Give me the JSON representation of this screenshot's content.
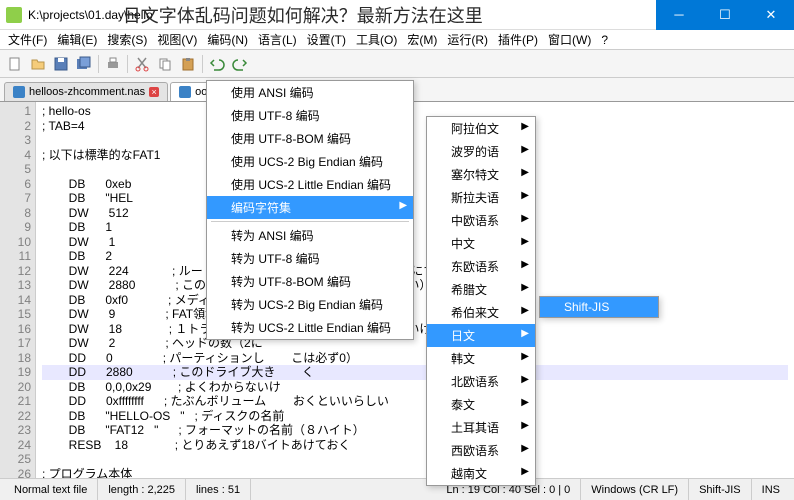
{
  "title_path": "K:\\projects\\01.day\\hello",
  "title_overlay": "日文字体乱码问题如何解决？最新方法在这里",
  "menubar": [
    "文件(F)",
    "编辑(E)",
    "搜索(S)",
    "视图(V)",
    "编码(N)",
    "语言(L)",
    "设置(T)",
    "工具(O)",
    "宏(M)",
    "运行(R)",
    "插件(P)",
    "窗口(W)",
    "?"
  ],
  "tabs": [
    {
      "label": "helloos-zhcomment.nas",
      "active": false
    },
    {
      "label": "oos.nas",
      "active": true
    }
  ],
  "code": [
    {
      "n": 1,
      "t": "; hello-os"
    },
    {
      "n": 2,
      "t": "; TAB=4"
    },
    {
      "n": 3,
      "t": ""
    },
    {
      "n": 4,
      "t": "; 以下は標準的なFAT1"
    },
    {
      "n": 5,
      "t": ""
    },
    {
      "n": 6,
      "t": "        DB      0xeb"
    },
    {
      "n": 7,
      "t": "        DB      \"HEL"
    },
    {
      "n": 8,
      "t": "        DW      512                                     てよい（８バイト）"
    },
    {
      "n": 9,
      "t": "        DB      1                                       ばいけない）"
    },
    {
      "n": 10,
      "t": "        DW      1                                       ければいけない）"
    },
    {
      "n": 11,
      "t": "        DB      2                                       セクタ目からにする）"
    },
    {
      "n": 12,
      "t": "        DW      224             ; ルートディレク          （普通は224エントリにす"
    },
    {
      "n": 13,
      "t": "        DW      2880            ; このドライブの          にしなければいけない）"
    },
    {
      "n": 14,
      "t": "        DB      0xf0            ; メディアのタイ"
    },
    {
      "n": 15,
      "t": "        DW      9               ; FAT領域の長さ"
    },
    {
      "n": 16,
      "t": "        DW      18              ; １トラックにいく        か（18にしなければいけない）"
    },
    {
      "n": 17,
      "t": "        DW      2               ; ヘッドの数（2に"
    },
    {
      "n": 18,
      "t": "        DD      0               ; パーティションし        こは必ず0）"
    },
    {
      "n": 19,
      "t": "        DD      2880            ; このドライブ大き        く",
      "hl": true
    },
    {
      "n": 20,
      "t": "        DB      0,0,0x29        ; よくわからないけ"
    },
    {
      "n": 21,
      "t": "        DD      0xffffffff      ; たぶんボリューム        おくといいらしい"
    },
    {
      "n": 22,
      "t": "        DB      \"HELLO-OS   \"   ; ディスクの名前"
    },
    {
      "n": 23,
      "t": "        DB      \"FAT12   \"      ; フォーマットの名前（８ハイト）"
    },
    {
      "n": 24,
      "t": "        RESB    18              ; とりあえず18バイトあけておく"
    },
    {
      "n": 25,
      "t": ""
    },
    {
      "n": 26,
      "t": "; プログラム本体"
    }
  ],
  "encoding_menu": {
    "items": [
      {
        "label": "使用 ANSI 编码"
      },
      {
        "label": "使用 UTF-8 编码"
      },
      {
        "label": "使用 UTF-8-BOM 编码"
      },
      {
        "label": "使用 UCS-2 Big Endian 编码"
      },
      {
        "label": "使用 UCS-2 Little Endian 编码"
      },
      {
        "label": "编码字符集",
        "sub": true,
        "sel": true
      },
      {
        "sep": true
      },
      {
        "label": "转为 ANSI 编码"
      },
      {
        "label": "转为 UTF-8 编码"
      },
      {
        "label": "转为 UTF-8-BOM 编码"
      },
      {
        "label": "转为 UCS-2 Big Endian 编码"
      },
      {
        "label": "转为 UCS-2 Little Endian 编码"
      }
    ]
  },
  "charset_menu": {
    "items": [
      {
        "label": "阿拉伯文",
        "sub": true
      },
      {
        "label": "波罗的语",
        "sub": true
      },
      {
        "label": "塞尔特文",
        "sub": true
      },
      {
        "label": "斯拉夫语",
        "sub": true
      },
      {
        "label": "中欧语系",
        "sub": true
      },
      {
        "label": "中文",
        "sub": true
      },
      {
        "label": "东欧语系",
        "sub": true
      },
      {
        "label": "希腊文",
        "sub": true
      },
      {
        "label": "希伯来文",
        "sub": true
      },
      {
        "label": "日文",
        "sub": true,
        "sel": true
      },
      {
        "label": "韩文",
        "sub": true
      },
      {
        "label": "北欧语系",
        "sub": true
      },
      {
        "label": "泰文",
        "sub": true
      },
      {
        "label": "土耳其语",
        "sub": true
      },
      {
        "label": "西欧语系",
        "sub": true
      },
      {
        "label": "越南文",
        "sub": true
      }
    ]
  },
  "jp_menu": {
    "items": [
      {
        "label": "Shift-JIS",
        "sel": true
      }
    ]
  },
  "status": {
    "type": "Normal text file",
    "length": "length : 2,225",
    "lines": "lines : 51",
    "pos": "Ln : 19   Col : 40   Sel : 0 | 0",
    "eol": "Windows (CR LF)",
    "enc": "Shift-JIS",
    "ins": "INS"
  }
}
